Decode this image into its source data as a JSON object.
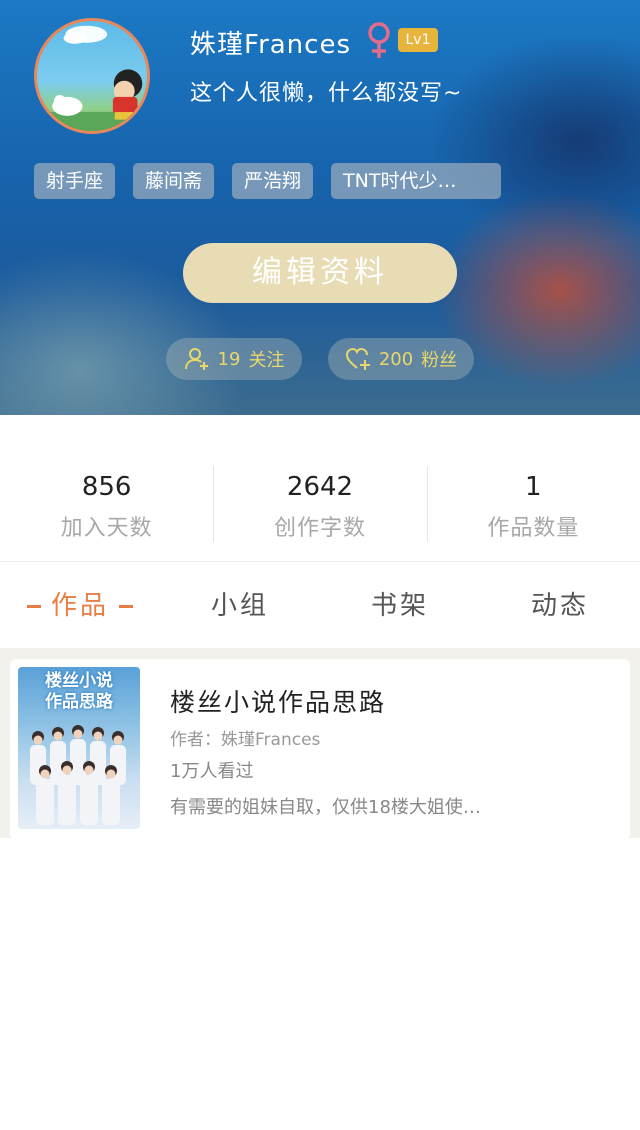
{
  "profile": {
    "username": "姝瑾Frances",
    "level": "Lv1",
    "bio": "这个人很懒，什么都没写~",
    "tags": [
      "射手座",
      "藤间斋",
      "严浩翔",
      "TNT时代少…"
    ],
    "edit_button": "编辑资料",
    "following": {
      "count": "19",
      "label": "关注",
      "icon": "person-add-icon"
    },
    "fans": {
      "count": "200",
      "label": "粉丝",
      "icon": "heart-add-icon"
    },
    "gender_icon": "female-icon"
  },
  "stats": [
    {
      "value": "856",
      "label": "加入天数"
    },
    {
      "value": "2642",
      "label": "创作字数"
    },
    {
      "value": "1",
      "label": "作品数量"
    }
  ],
  "tabs": [
    {
      "label": "作品",
      "active": true
    },
    {
      "label": "小组",
      "active": false
    },
    {
      "label": "书架",
      "active": false
    },
    {
      "label": "动态",
      "active": false
    }
  ],
  "works": [
    {
      "title": "楼丝小说作品思路",
      "author": "作者：姝瑾Frances",
      "views": "1万人看过",
      "description": "有需要的姐妹自取，仅供18楼大姐使…",
      "cover_text_line1": "楼丝小说",
      "cover_text_line2": "作品思路"
    }
  ],
  "colors": {
    "accent": "#e67e46",
    "level_badge": "#e8b53c",
    "edit_button_bg": "#e8dcb4",
    "pill_text": "#e8d86b",
    "gender_icon": "#e46b8a"
  }
}
